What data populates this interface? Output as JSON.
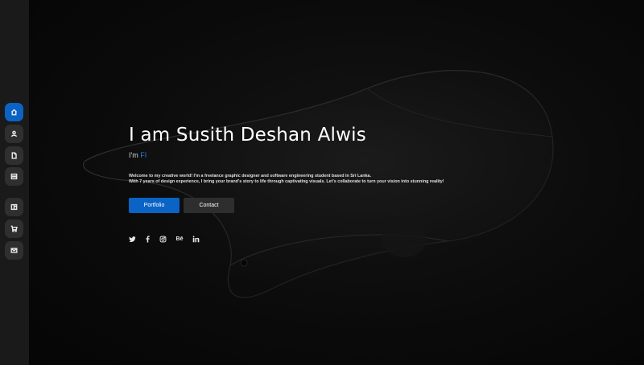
{
  "sidebar": {
    "items": [
      {
        "name": "home",
        "icon": "home-icon",
        "active": true
      },
      {
        "name": "about",
        "icon": "user-icon",
        "active": false
      },
      {
        "name": "resume",
        "icon": "document-icon",
        "active": false
      },
      {
        "name": "services",
        "icon": "server-icon",
        "active": false
      },
      {
        "name": "portfolio",
        "icon": "book-icon",
        "active": false
      },
      {
        "name": "shop",
        "icon": "cart-icon",
        "active": false
      },
      {
        "name": "contact",
        "icon": "envelope-icon",
        "active": false
      }
    ]
  },
  "hero": {
    "title": "I am Susith Deshan Alwis",
    "subtitle_prefix": "I'm ",
    "subtitle_typed": "FI",
    "description_line1": "Welcome to my creative world! I'm a freelance graphic designer and software engineering student based in Sri Lanka.",
    "description_line2": "With 7 years of design experience, I bring your brand's story to life through captivating visuals. Let's collaborate to turn your vision into stunning reality!",
    "buttons": {
      "primary": "Portfolio",
      "secondary": "Contact"
    },
    "socials": [
      {
        "name": "twitter",
        "icon": "twitter-icon"
      },
      {
        "name": "facebook",
        "icon": "facebook-icon"
      },
      {
        "name": "instagram",
        "icon": "instagram-icon"
      },
      {
        "name": "behance",
        "icon": "behance-icon",
        "text": "Bē"
      },
      {
        "name": "linkedin",
        "icon": "linkedin-icon"
      }
    ]
  },
  "colors": {
    "accent": "#0b63c5",
    "background": "#0a0a0a",
    "sidebar": "#1a1a1a",
    "button_dark": "#2e2e2e"
  }
}
